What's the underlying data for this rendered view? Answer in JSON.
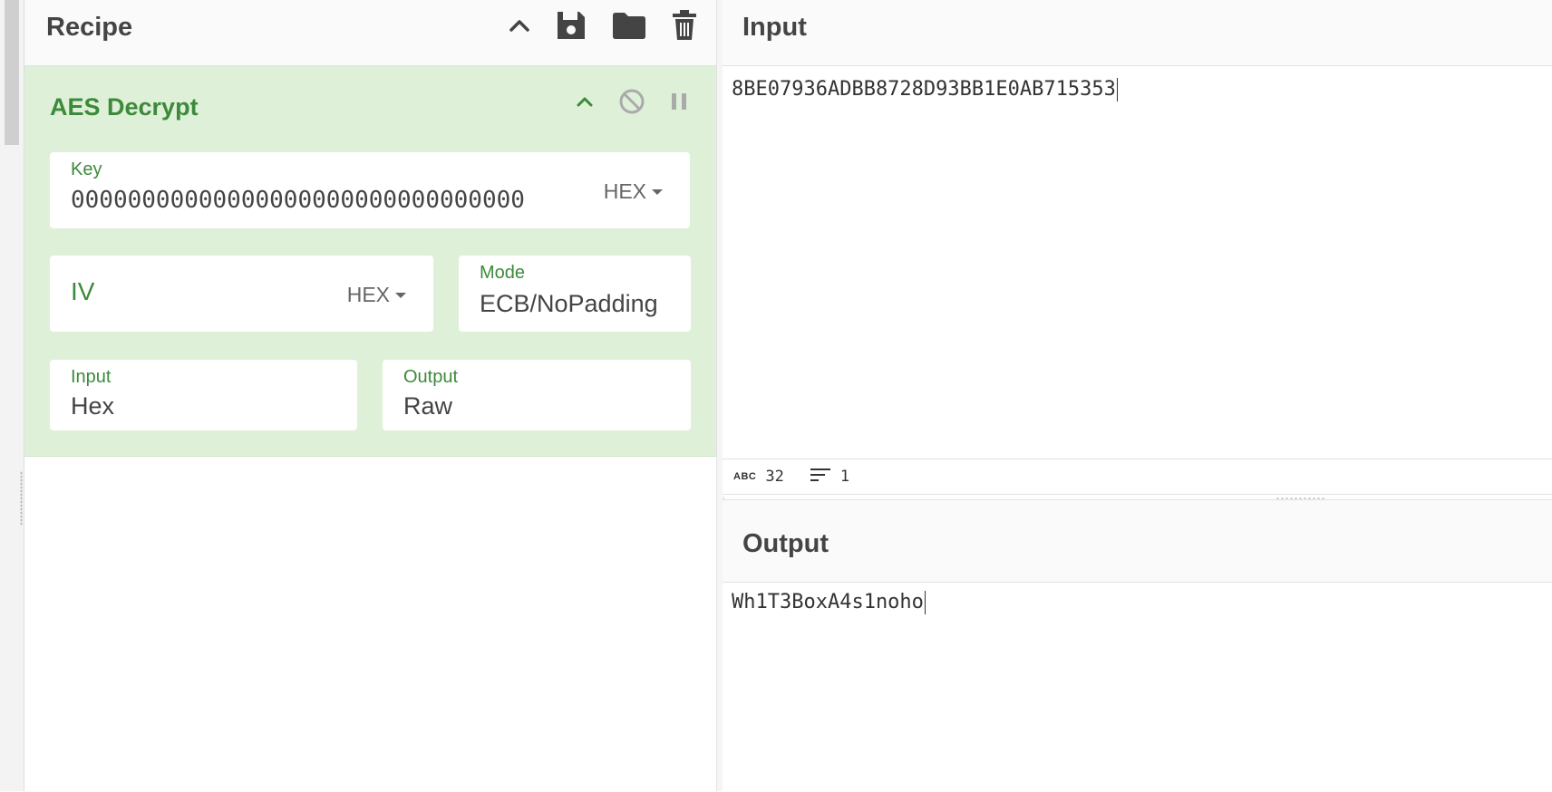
{
  "recipe": {
    "title": "Recipe",
    "header_icons": [
      "chevron-up-icon",
      "save-icon",
      "folder-icon",
      "trash-icon"
    ]
  },
  "operation": {
    "name": "AES Decrypt",
    "controls": [
      "chevron-up-icon",
      "disable-icon",
      "pause-icon"
    ],
    "key": {
      "label": "Key",
      "value": "00000000000000000000000000000000",
      "format": "HEX"
    },
    "iv": {
      "label": "IV",
      "value": "",
      "format": "HEX"
    },
    "mode": {
      "label": "Mode",
      "value": "ECB/NoPadding"
    },
    "input": {
      "label": "Input",
      "value": "Hex"
    },
    "output": {
      "label": "Output",
      "value": "Raw"
    }
  },
  "input_pane": {
    "title": "Input",
    "text": "8BE07936ADBB8728D93BB1E0AB715353",
    "status": {
      "length": "32",
      "lines": "1"
    }
  },
  "output_pane": {
    "title": "Output",
    "text": "Wh1T3BoxA4s1noho"
  },
  "colors": {
    "accent_green": "#3c8a3a",
    "op_background": "#dff0d8"
  }
}
